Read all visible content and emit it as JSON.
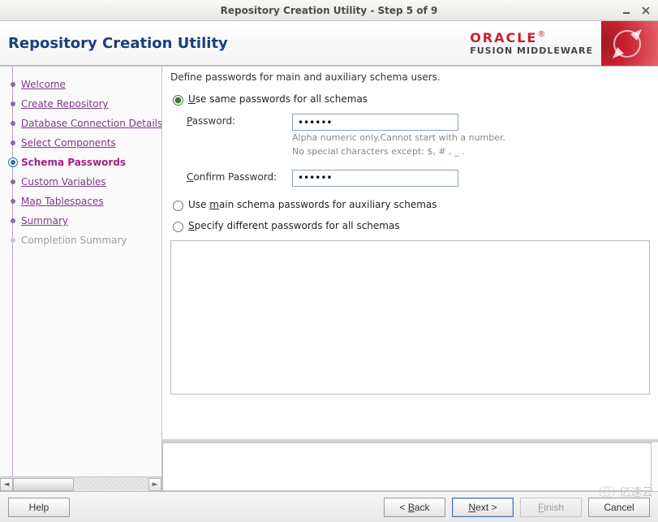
{
  "window": {
    "title": "Repository Creation Utility - Step 5 of 9"
  },
  "banner": {
    "title": "Repository Creation Utility",
    "brand_top": "ORACLE",
    "brand_sub": "FUSION MIDDLEWARE"
  },
  "sidebar": {
    "steps": [
      {
        "label": "Welcome",
        "state": "done"
      },
      {
        "label": "Create Repository",
        "state": "done"
      },
      {
        "label": "Database Connection Details",
        "state": "done"
      },
      {
        "label": "Select Components",
        "state": "done"
      },
      {
        "label": "Schema Passwords",
        "state": "active"
      },
      {
        "label": "Custom Variables",
        "state": "pending"
      },
      {
        "label": "Map Tablespaces",
        "state": "pending"
      },
      {
        "label": "Summary",
        "state": "pending"
      },
      {
        "label": "Completion Summary",
        "state": "disabled"
      }
    ]
  },
  "main": {
    "instruction": "Define passwords for main and auxiliary schema users.",
    "option_same": {
      "prefix": "U",
      "rest": "se same passwords for all schemas",
      "checked": true
    },
    "option_main": {
      "text_before": "Use ",
      "prefix": "m",
      "rest": "ain schema passwords for auxiliary schemas",
      "checked": false
    },
    "option_diff": {
      "prefix": "S",
      "rest": "pecify different passwords for all schemas",
      "checked": false
    },
    "password": {
      "label_prefix": "P",
      "label_rest": "assword:",
      "value": "••••••",
      "hint1": "Alpha numeric only.Cannot start with a number.",
      "hint2": "No special characters except: $, # , _ ."
    },
    "confirm": {
      "label_prefix": "C",
      "label_rest": "onfirm Password:",
      "value": "••••••"
    }
  },
  "footer": {
    "help": "Help",
    "back": "< Back",
    "next": "Next >",
    "finish": "Finish",
    "cancel": "Cancel"
  },
  "watermark": "亿速云"
}
